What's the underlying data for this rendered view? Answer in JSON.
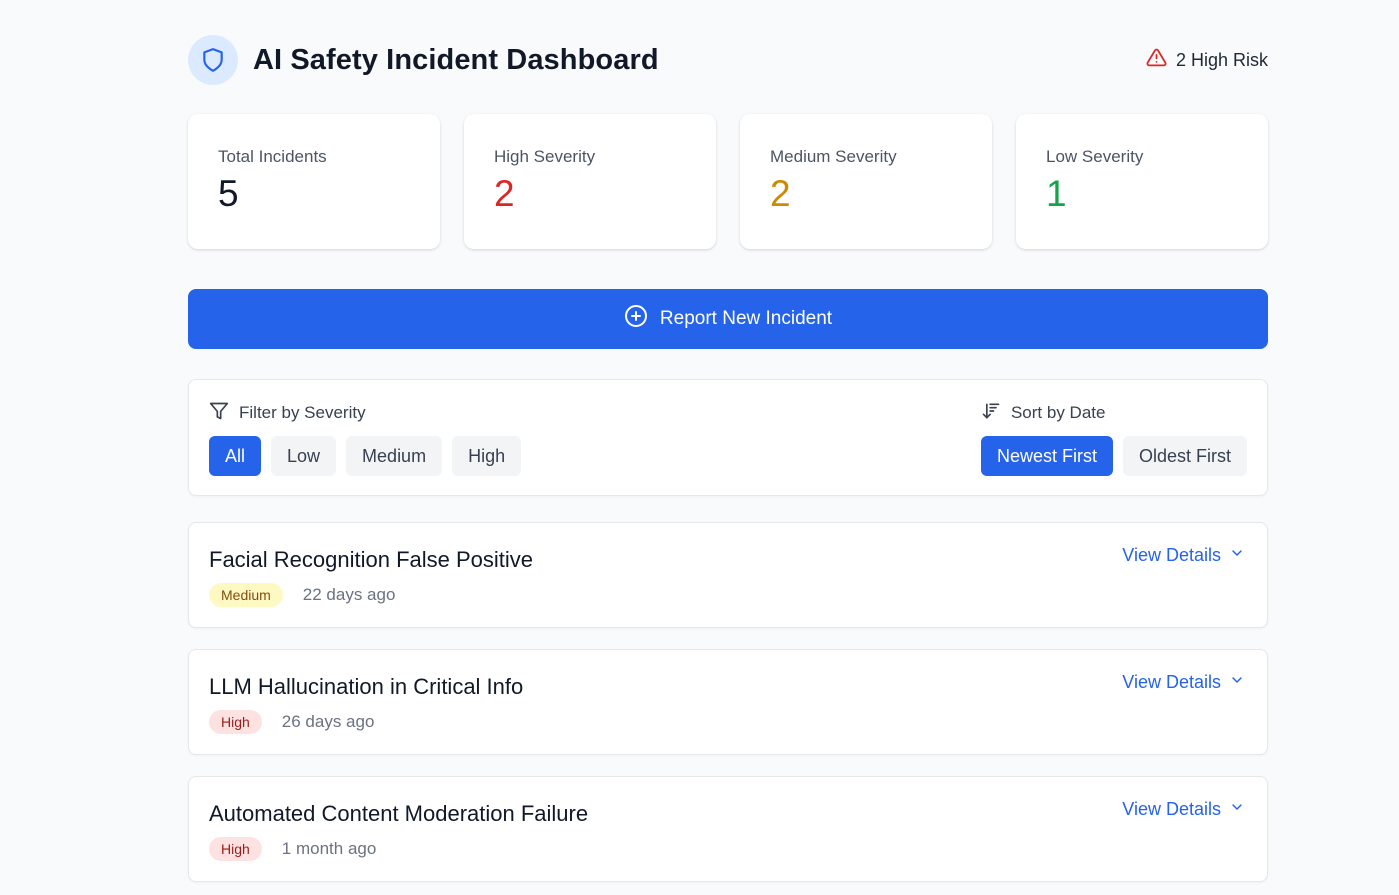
{
  "header": {
    "title": "AI Safety Incident Dashboard",
    "risk_label": "2 High Risk"
  },
  "stats": [
    {
      "label": "Total Incidents",
      "value": "5",
      "color": "#111827"
    },
    {
      "label": "High Severity",
      "value": "2",
      "color": "#dc2626"
    },
    {
      "label": "Medium Severity",
      "value": "2",
      "color": "#ca8a04"
    },
    {
      "label": "Low Severity",
      "value": "1",
      "color": "#16a34a"
    }
  ],
  "report_button": {
    "label": "Report New Incident"
  },
  "filter": {
    "heading": "Filter by Severity",
    "options": [
      "All",
      "Low",
      "Medium",
      "High"
    ],
    "selected": "All"
  },
  "sort": {
    "heading": "Sort by Date",
    "options": [
      "Newest First",
      "Oldest First"
    ],
    "selected": "Newest First"
  },
  "incidents": [
    {
      "title": "Facial Recognition False Positive",
      "severity": "Medium",
      "age": "22 days ago",
      "action": "View Details"
    },
    {
      "title": "LLM Hallucination in Critical Info",
      "severity": "High",
      "age": "26 days ago",
      "action": "View Details"
    },
    {
      "title": "Automated Content Moderation Failure",
      "severity": "High",
      "age": "1 month ago",
      "action": "View Details"
    }
  ],
  "colors": {
    "accent": "#2563eb",
    "high": "#dc2626",
    "medium": "#ca8a04",
    "low": "#16a34a"
  },
  "icons": {
    "brand": "shield-icon",
    "risk": "alert-triangle-icon",
    "report": "plus-circle-icon",
    "filter": "filter-icon",
    "sort": "sort-descending-icon",
    "details": "chevron-down-icon"
  }
}
